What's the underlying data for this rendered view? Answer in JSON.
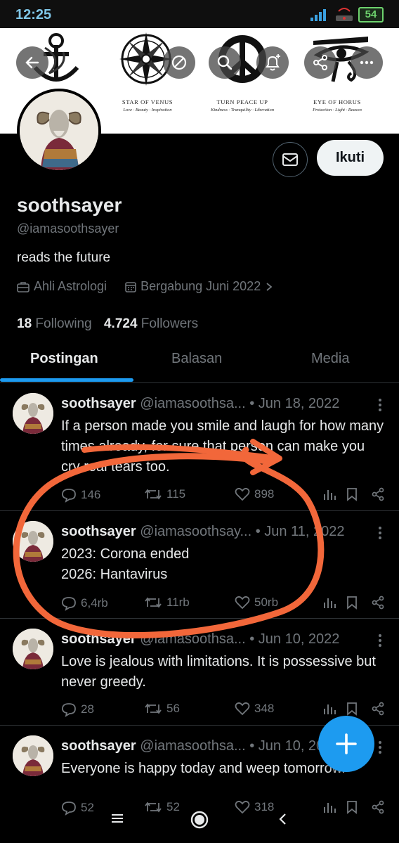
{
  "status_bar": {
    "time": "12:25",
    "battery": "54"
  },
  "banner": {
    "emblems": [
      {
        "title": "STAR OF VENUS",
        "subtitle": "Love · Beauty · Inspiration"
      },
      {
        "title": "TURN PEACE UP",
        "subtitle": "Kindness · Tranquility · Liberation"
      },
      {
        "title": "EYE OF HORUS",
        "subtitle": "Protection · Light · Reason"
      }
    ]
  },
  "header_icons": [
    "back-icon",
    "block-icon",
    "search-icon",
    "notify-add-icon",
    "share-icon",
    "more-icon"
  ],
  "profile": {
    "name": "soothsayer",
    "handle": "@iamasoothsayer",
    "bio": "reads the future",
    "category": "Ahli Astrologi",
    "joined": "Bergabung Juni 2022",
    "following_count": "18",
    "following_label": "Following",
    "followers_count": "4.724",
    "followers_label": "Followers",
    "follow_button": "Ikuti"
  },
  "tabs": [
    "Postingan",
    "Balasan",
    "Media"
  ],
  "active_tab": "Postingan",
  "posts": [
    {
      "name": "soothsayer",
      "handle_date": "@iamasoothsa... • Jun 18, 2022",
      "text": "If a person made you smile and laugh for how many times already, for sure that person can make you cry real tears too.",
      "replies": "146",
      "reposts": "115",
      "likes": "898"
    },
    {
      "name": "soothsayer",
      "handle_date": "@iamasoothsay... • Jun 11, 2022",
      "text_lines": [
        "2023: Corona ended",
        "2026: Hantavirus"
      ],
      "replies": "6,4rb",
      "reposts": "11rb",
      "likes": "50rb"
    },
    {
      "name": "soothsayer",
      "handle_date": "@iamasoothsa... • Jun 10, 2022",
      "text": "Love is jealous with limitations. It is possessive but never greedy.",
      "replies": "28",
      "reposts": "56",
      "likes": "348"
    },
    {
      "name": "soothsayer",
      "handle_date": "@iamasoothsa... • Jun 10, 2022",
      "text": "Everyone is happy today and weep tomorrow.",
      "replies": "52",
      "reposts": "52",
      "likes": "318"
    }
  ],
  "colors": {
    "accent": "#1d9bf0",
    "annotation": "#f2673a",
    "muted": "#71767b",
    "text": "#e7e9ea"
  }
}
